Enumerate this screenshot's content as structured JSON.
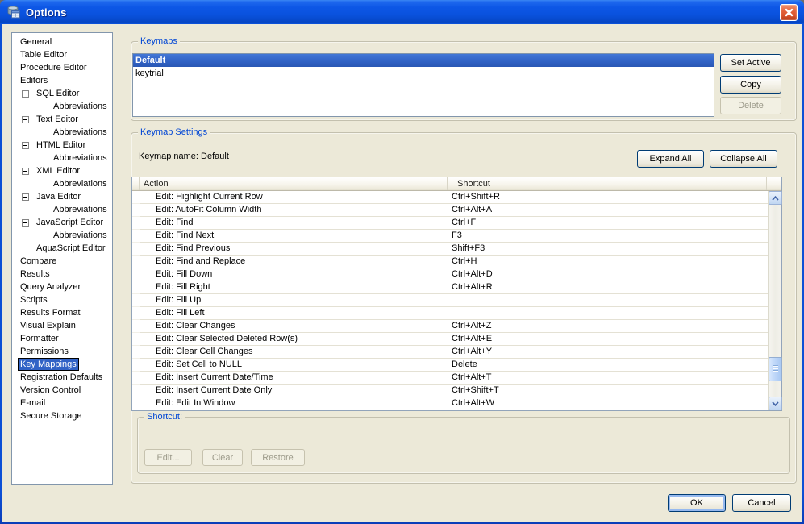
{
  "window": {
    "title": "Options"
  },
  "colors": {
    "window-border": "#0D50D6",
    "dialog-bg": "#ECE9D8",
    "group-label": "#0046D5",
    "selection-blue": "#3163C6",
    "field-border": "#8296AC",
    "close-red": "#D9532C",
    "button-border": "#003C74",
    "disabled-text": "#9C9A8A"
  },
  "icons": {
    "app": "database-table-icon",
    "close": "close-icon",
    "scroll_up": "chevron-up-icon",
    "scroll_down": "chevron-down-icon",
    "expander": "collapse-minus-icon"
  },
  "sidebar": {
    "items": [
      {
        "label": "General",
        "type": "root"
      },
      {
        "label": "Table Editor",
        "type": "root"
      },
      {
        "label": "Procedure Editor",
        "type": "root"
      },
      {
        "label": "Editors",
        "type": "root"
      },
      {
        "label": "SQL Editor",
        "type": "editor"
      },
      {
        "label": "Abbreviations",
        "type": "abbrev"
      },
      {
        "label": "Text Editor",
        "type": "editor"
      },
      {
        "label": "Abbreviations",
        "type": "abbrev"
      },
      {
        "label": "HTML Editor",
        "type": "editor"
      },
      {
        "label": "Abbreviations",
        "type": "abbrev"
      },
      {
        "label": "XML Editor",
        "type": "editor"
      },
      {
        "label": "Abbreviations",
        "type": "abbrev"
      },
      {
        "label": "Java Editor",
        "type": "editor"
      },
      {
        "label": "Abbreviations",
        "type": "abbrev"
      },
      {
        "label": "JavaScript Editor",
        "type": "editor"
      },
      {
        "label": "Abbreviations",
        "type": "abbrev"
      },
      {
        "label": "AquaScript Editor",
        "type": "child"
      },
      {
        "label": "Compare",
        "type": "root"
      },
      {
        "label": "Results",
        "type": "root"
      },
      {
        "label": "Query Analyzer",
        "type": "root"
      },
      {
        "label": "Scripts",
        "type": "root"
      },
      {
        "label": "Results Format",
        "type": "root"
      },
      {
        "label": "Visual Explain",
        "type": "root"
      },
      {
        "label": "Formatter",
        "type": "root"
      },
      {
        "label": "Permissions",
        "type": "root"
      },
      {
        "label": "Key Mappings",
        "type": "root",
        "selected": true
      },
      {
        "label": "Registration Defaults",
        "type": "root"
      },
      {
        "label": "Version Control",
        "type": "root"
      },
      {
        "label": "E-mail",
        "type": "root"
      },
      {
        "label": "Secure Storage",
        "type": "root"
      }
    ]
  },
  "keymaps": {
    "group_label": "Keymaps",
    "list": [
      {
        "label": "Default",
        "selected": true
      },
      {
        "label": "keytrial",
        "selected": false
      }
    ],
    "buttons": [
      {
        "label": "Set Active",
        "enabled": true
      },
      {
        "label": "Copy",
        "enabled": true
      },
      {
        "label": "Delete",
        "enabled": false
      }
    ]
  },
  "keymap_settings": {
    "group_label": "Keymap Settings",
    "keymap_name": "Keymap name: Default",
    "expand_all_label": "Expand All",
    "collapse_all_label": "Collapse All",
    "table": {
      "columns": [
        "Action",
        "Shortcut"
      ],
      "rows": [
        {
          "action": "Edit: Highlight Current Row",
          "shortcut": "Ctrl+Shift+R"
        },
        {
          "action": "Edit: AutoFit Column Width",
          "shortcut": "Ctrl+Alt+A"
        },
        {
          "action": "Edit: Find",
          "shortcut": "Ctrl+F"
        },
        {
          "action": "Edit: Find Next",
          "shortcut": "F3"
        },
        {
          "action": "Edit: Find Previous",
          "shortcut": "Shift+F3"
        },
        {
          "action": "Edit: Find and Replace",
          "shortcut": "Ctrl+H"
        },
        {
          "action": "Edit: Fill Down",
          "shortcut": "Ctrl+Alt+D"
        },
        {
          "action": "Edit: Fill Right",
          "shortcut": "Ctrl+Alt+R"
        },
        {
          "action": "Edit: Fill Up",
          "shortcut": ""
        },
        {
          "action": "Edit: Fill Left",
          "shortcut": ""
        },
        {
          "action": "Edit: Clear Changes",
          "shortcut": "Ctrl+Alt+Z"
        },
        {
          "action": "Edit: Clear Selected Deleted Row(s)",
          "shortcut": "Ctrl+Alt+E"
        },
        {
          "action": "Edit: Clear Cell Changes",
          "shortcut": "Ctrl+Alt+Y"
        },
        {
          "action": "Edit: Set Cell to NULL",
          "shortcut": "Delete"
        },
        {
          "action": "Edit: Insert Current Date/Time",
          "shortcut": "Ctrl+Alt+T"
        },
        {
          "action": "Edit: Insert Current Date Only",
          "shortcut": "Ctrl+Shift+T"
        },
        {
          "action": "Edit: Edit In Window",
          "shortcut": "Ctrl+Alt+W"
        }
      ]
    },
    "shortcut_group": {
      "label": "Shortcut:",
      "buttons": [
        {
          "label": "Edit...",
          "enabled": false
        },
        {
          "label": "Clear",
          "enabled": false
        },
        {
          "label": "Restore",
          "enabled": false
        }
      ]
    }
  },
  "footer": {
    "ok_label": "OK",
    "cancel_label": "Cancel"
  }
}
